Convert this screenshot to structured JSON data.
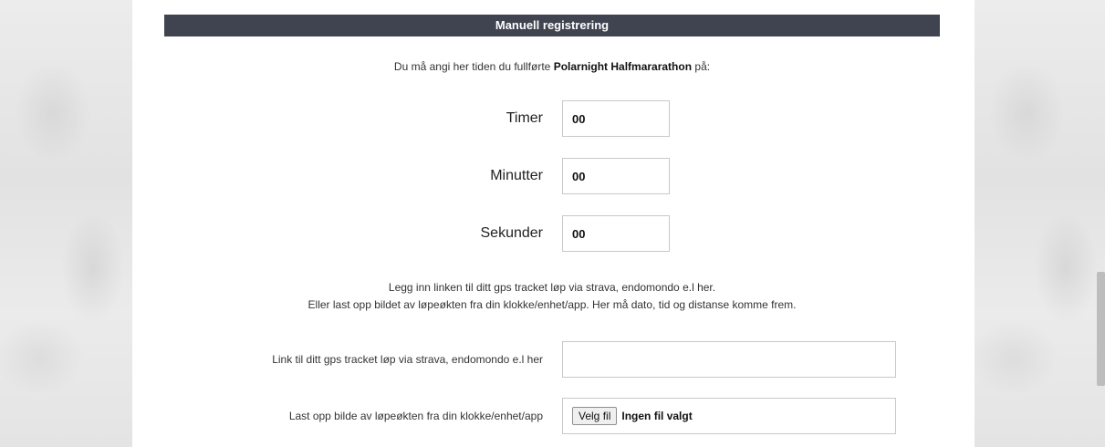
{
  "panel": {
    "title": "Manuell registrering"
  },
  "intro": {
    "prefix": "Du må angi her tiden du fullførte",
    "event": "Polarnight Halfmararathon",
    "suffix": "på:"
  },
  "time_fields": {
    "hours": {
      "label": "Timer",
      "value": "00"
    },
    "minutes": {
      "label": "Minutter",
      "value": "00"
    },
    "seconds": {
      "label": "Sekunder",
      "value": "00"
    }
  },
  "info": {
    "line1": "Legg inn linken til ditt gps tracket løp via strava, endomondo e.l her.",
    "line2": "Eller last opp bildet av løpeøkten fra din klokke/enhet/app. Her må dato, tid og distanse komme frem."
  },
  "link_field": {
    "label": "Link til ditt gps tracket løp via strava, endomondo e.l her",
    "value": ""
  },
  "upload_field": {
    "label": "Last opp bilde av løpeøkten fra din klokke/enhet/app",
    "button_label": "Velg fil",
    "status": "Ingen fil valgt"
  },
  "colors": {
    "header_bg": "#3f4450",
    "header_text": "#ffffff",
    "side_photo": "#e6e6e6"
  }
}
